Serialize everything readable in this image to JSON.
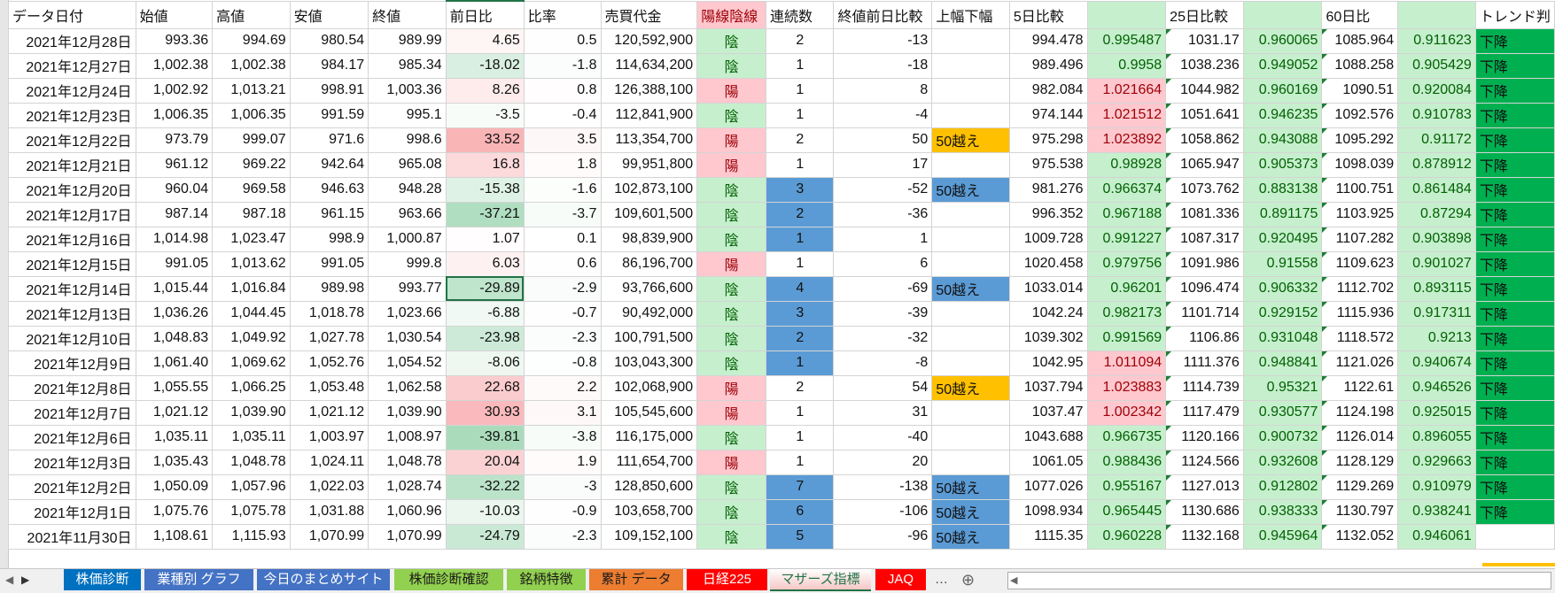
{
  "columns": [
    "データ日付",
    "始値",
    "高値",
    "安値",
    "終値",
    "前日比",
    "比率",
    "売買代金",
    "陽線陰線",
    "連続数",
    "終値前日比較",
    "上幅下幅",
    "5日比較",
    "",
    "25日比較",
    "",
    "60日比",
    "",
    "トレンド判"
  ],
  "rows": [
    {
      "cells": [
        "2021年12月28日",
        "993.36",
        "994.69",
        "980.54",
        "989.99",
        "4.65",
        "0.5",
        "120,592,900",
        "陰",
        "2",
        "-13",
        "",
        "994.478",
        "0.995487",
        "1031.17",
        "0.960065",
        "1085.964",
        "0.911623",
        "下降"
      ],
      "streak_highlight": false
    },
    {
      "cells": [
        "2021年12月27日",
        "1,002.38",
        "1,002.38",
        "984.17",
        "985.34",
        "-18.02",
        "-1.8",
        "114,634,200",
        "陰",
        "1",
        "-18",
        "",
        "989.496",
        "0.9958",
        "1038.236",
        "0.949052",
        "1088.258",
        "0.905429",
        "下降"
      ],
      "streak_highlight": false
    },
    {
      "cells": [
        "2021年12月24日",
        "1,002.92",
        "1,013.21",
        "998.91",
        "1,003.36",
        "8.26",
        "0.8",
        "126,388,100",
        "陽",
        "1",
        "8",
        "",
        "982.084",
        "1.021664",
        "1044.982",
        "0.960169",
        "1090.51",
        "0.920084",
        "下降"
      ],
      "streak_highlight": false
    },
    {
      "cells": [
        "2021年12月23日",
        "1,006.35",
        "1,006.35",
        "991.59",
        "995.1",
        "-3.5",
        "-0.4",
        "112,841,900",
        "陰",
        "1",
        "-4",
        "",
        "974.144",
        "1.021512",
        "1051.641",
        "0.946235",
        "1092.576",
        "0.910783",
        "下降"
      ],
      "streak_highlight": false
    },
    {
      "cells": [
        "2021年12月22日",
        "973.79",
        "999.07",
        "971.6",
        "998.6",
        "33.52",
        "3.5",
        "113,354,700",
        "陽",
        "2",
        "50",
        "50越え",
        "975.298",
        "1.023892",
        "1058.862",
        "0.943088",
        "1095.292",
        "0.91172",
        "下降"
      ],
      "streak_highlight": false
    },
    {
      "cells": [
        "2021年12月21日",
        "961.12",
        "969.22",
        "942.64",
        "965.08",
        "16.8",
        "1.8",
        "99,951,800",
        "陽",
        "1",
        "17",
        "",
        "975.538",
        "0.98928",
        "1065.947",
        "0.905373",
        "1098.039",
        "0.878912",
        "下降"
      ],
      "streak_highlight": false
    },
    {
      "cells": [
        "2021年12月20日",
        "960.04",
        "969.58",
        "946.63",
        "948.28",
        "-15.38",
        "-1.6",
        "102,873,100",
        "陰",
        "3",
        "-52",
        "50越え",
        "981.276",
        "0.966374",
        "1073.762",
        "0.883138",
        "1100.751",
        "0.861484",
        "下降"
      ],
      "streak_highlight": true
    },
    {
      "cells": [
        "2021年12月17日",
        "987.14",
        "987.18",
        "961.15",
        "963.66",
        "-37.21",
        "-3.7",
        "109,601,500",
        "陰",
        "2",
        "-36",
        "",
        "996.352",
        "0.967188",
        "1081.336",
        "0.891175",
        "1103.925",
        "0.87294",
        "下降"
      ],
      "streak_highlight": true
    },
    {
      "cells": [
        "2021年12月16日",
        "1,014.98",
        "1,023.47",
        "998.9",
        "1,000.87",
        "1.07",
        "0.1",
        "98,839,900",
        "陰",
        "1",
        "1",
        "",
        "1009.728",
        "0.991227",
        "1087.317",
        "0.920495",
        "1107.282",
        "0.903898",
        "下降"
      ],
      "streak_highlight": true
    },
    {
      "cells": [
        "2021年12月15日",
        "991.05",
        "1,013.62",
        "991.05",
        "999.8",
        "6.03",
        "0.6",
        "86,196,700",
        "陽",
        "1",
        "6",
        "",
        "1020.458",
        "0.979756",
        "1091.986",
        "0.91558",
        "1109.623",
        "0.901027",
        "下降"
      ],
      "streak_highlight": false
    },
    {
      "cells": [
        "2021年12月14日",
        "1,015.44",
        "1,016.84",
        "989.98",
        "993.77",
        "-29.89",
        "-2.9",
        "93,766,600",
        "陰",
        "4",
        "-69",
        "50越え",
        "1033.014",
        "0.96201",
        "1096.474",
        "0.906332",
        "1112.702",
        "0.893115",
        "下降"
      ],
      "streak_highlight": true,
      "selected_col": 5
    },
    {
      "cells": [
        "2021年12月13日",
        "1,036.26",
        "1,044.45",
        "1,018.78",
        "1,023.66",
        "-6.88",
        "-0.7",
        "90,492,000",
        "陰",
        "3",
        "-39",
        "",
        "1042.24",
        "0.982173",
        "1101.714",
        "0.929152",
        "1115.936",
        "0.917311",
        "下降"
      ],
      "streak_highlight": true
    },
    {
      "cells": [
        "2021年12月10日",
        "1,048.83",
        "1,049.92",
        "1,027.78",
        "1,030.54",
        "-23.98",
        "-2.3",
        "100,791,500",
        "陰",
        "2",
        "-32",
        "",
        "1039.302",
        "0.991569",
        "1106.86",
        "0.931048",
        "1118.572",
        "0.9213",
        "下降"
      ],
      "streak_highlight": true
    },
    {
      "cells": [
        "2021年12月9日",
        "1,061.40",
        "1,069.62",
        "1,052.76",
        "1,054.52",
        "-8.06",
        "-0.8",
        "103,043,300",
        "陰",
        "1",
        "-8",
        "",
        "1042.95",
        "1.011094",
        "1111.376",
        "0.948841",
        "1121.026",
        "0.940674",
        "下降"
      ],
      "streak_highlight": true
    },
    {
      "cells": [
        "2021年12月8日",
        "1,055.55",
        "1,066.25",
        "1,053.48",
        "1,062.58",
        "22.68",
        "2.2",
        "102,068,900",
        "陽",
        "2",
        "54",
        "50越え",
        "1037.794",
        "1.023883",
        "1114.739",
        "0.95321",
        "1122.61",
        "0.946526",
        "下降"
      ],
      "streak_highlight": false
    },
    {
      "cells": [
        "2021年12月7日",
        "1,021.12",
        "1,039.90",
        "1,021.12",
        "1,039.90",
        "30.93",
        "3.1",
        "105,545,600",
        "陽",
        "1",
        "31",
        "",
        "1037.47",
        "1.002342",
        "1117.479",
        "0.930577",
        "1124.198",
        "0.925015",
        "下降"
      ],
      "streak_highlight": false
    },
    {
      "cells": [
        "2021年12月6日",
        "1,035.11",
        "1,035.11",
        "1,003.97",
        "1,008.97",
        "-39.81",
        "-3.8",
        "116,175,000",
        "陰",
        "1",
        "-40",
        "",
        "1043.688",
        "0.966735",
        "1120.166",
        "0.900732",
        "1126.014",
        "0.896055",
        "下降"
      ],
      "streak_highlight": false
    },
    {
      "cells": [
        "2021年12月3日",
        "1,035.43",
        "1,048.78",
        "1,024.11",
        "1,048.78",
        "20.04",
        "1.9",
        "111,654,700",
        "陽",
        "1",
        "20",
        "",
        "1061.05",
        "0.988436",
        "1124.566",
        "0.932608",
        "1128.129",
        "0.929663",
        "下降"
      ],
      "streak_highlight": false
    },
    {
      "cells": [
        "2021年12月2日",
        "1,050.09",
        "1,057.96",
        "1,022.03",
        "1,028.74",
        "-32.22",
        "-3",
        "128,850,600",
        "陰",
        "7",
        "-138",
        "50越え",
        "1077.026",
        "0.955167",
        "1127.013",
        "0.912802",
        "1129.269",
        "0.910979",
        "下降"
      ],
      "streak_highlight": true
    },
    {
      "cells": [
        "2021年12月1日",
        "1,075.76",
        "1,075.78",
        "1,031.88",
        "1,060.96",
        "-10.03",
        "-0.9",
        "103,658,700",
        "陰",
        "6",
        "-106",
        "50越え",
        "1098.934",
        "0.965445",
        "1130.686",
        "0.938333",
        "1130.797",
        "0.938241",
        "下降"
      ],
      "streak_highlight": true
    },
    {
      "cells": [
        "2021年11月30日",
        "1,108.61",
        "1,115.93",
        "1,070.99",
        "1,070.99",
        "-24.79",
        "-2.3",
        "109,152,100",
        "陰",
        "5",
        "-96",
        "50越え",
        "1115.35",
        "0.960228",
        "1132.168",
        "0.945964",
        "1132.052",
        "0.946061",
        ""
      ],
      "streak_highlight": true
    }
  ],
  "sheet_tabs": [
    {
      "label": "株価診断",
      "color": "#0070c0",
      "text": "#ffffff"
    },
    {
      "label": "業種別 グラフ",
      "color": "#4472c4",
      "text": "#ffffff"
    },
    {
      "label": "今日のまとめサイト",
      "color": "#4472c4",
      "text": "#ffffff"
    },
    {
      "label": "株価診断確認",
      "color": "#92d050",
      "text": "#1a1a1a"
    },
    {
      "label": "銘柄特徴",
      "color": "#92d050",
      "text": "#1a1a1a"
    },
    {
      "label": "累計 データ",
      "color": "#ed7d31",
      "text": "#1a1a1a"
    },
    {
      "label": "日経225",
      "color": "#ff0000",
      "text": "#ffffff"
    },
    {
      "label": "マザーズ指標",
      "color": "#ffffff",
      "text": "#217346",
      "active": true
    },
    {
      "label": "JAQ",
      "color": "#ff0000",
      "text": "#ffffff"
    }
  ],
  "tab_more": "…",
  "add_sheet": "⊕",
  "colors": {
    "up_bg": "#ffc7ce",
    "up_text": "#9c0006",
    "down_bg": "#c6efce",
    "down_text": "#006100",
    "streak": "#5b9bd5",
    "trend": "#00b050"
  }
}
